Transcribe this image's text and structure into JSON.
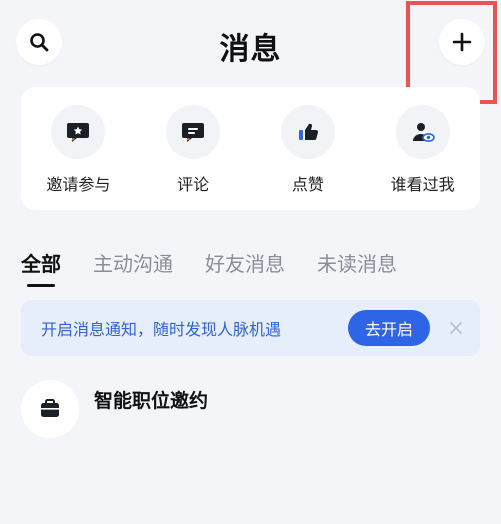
{
  "header": {
    "title": "消息",
    "search_icon": "search-icon",
    "add_icon": "plus-icon",
    "highlight_color": "#e8544f"
  },
  "shortcuts": [
    {
      "label": "邀请参与",
      "icon": "invite-star-icon"
    },
    {
      "label": "评论",
      "icon": "comment-icon"
    },
    {
      "label": "点赞",
      "icon": "thumbs-up-icon"
    },
    {
      "label": "谁看过我",
      "icon": "viewer-eye-icon"
    }
  ],
  "tabs": [
    {
      "label": "全部",
      "active": true
    },
    {
      "label": "主动沟通",
      "active": false
    },
    {
      "label": "好友消息",
      "active": false
    },
    {
      "label": "未读消息",
      "active": false
    }
  ],
  "notice": {
    "text": "开启消息通知，随时发现人脉机遇",
    "button_label": "去开启",
    "accent": "#2e65e6",
    "close_icon": "close-icon"
  },
  "list": [
    {
      "title": "智能职位邀约",
      "icon": "briefcase-icon"
    }
  ]
}
